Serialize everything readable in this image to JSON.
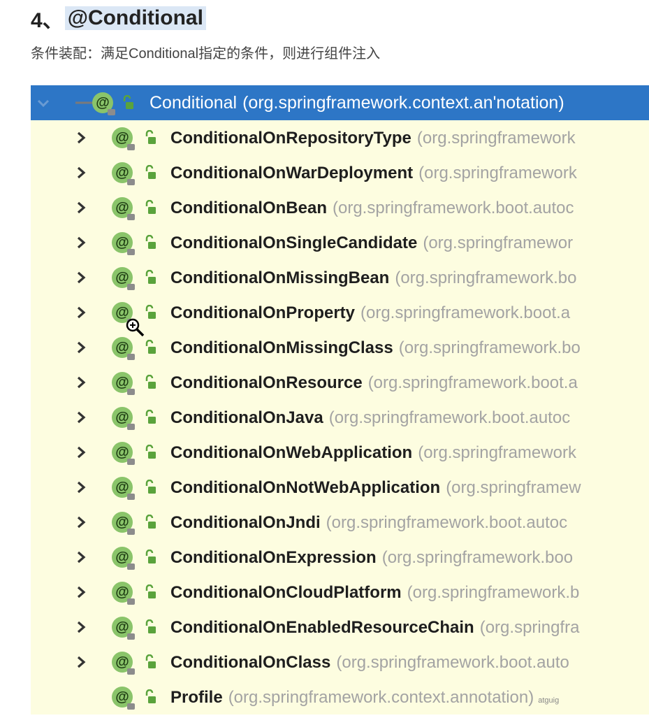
{
  "heading": {
    "number": "4、",
    "title": "@Conditional"
  },
  "description": "条件装配：满足Conditional指定的条件，则进行组件注入",
  "tree": {
    "root": {
      "name": "Conditional",
      "package": "(org.springframework.context.an'notation)"
    },
    "items": [
      {
        "name": "ConditionalOnRepositoryType",
        "package": "(org.springframework"
      },
      {
        "name": "ConditionalOnWarDeployment",
        "package": "(org.springframework"
      },
      {
        "name": "ConditionalOnBean",
        "package": "(org.springframework.boot.autoc"
      },
      {
        "name": "ConditionalOnSingleCandidate",
        "package": "(org.springframewor"
      },
      {
        "name": "ConditionalOnMissingBean",
        "package": "(org.springframework.bo"
      },
      {
        "name": "ConditionalOnProperty",
        "package": "(org.springframework.boot.a"
      },
      {
        "name": "ConditionalOnMissingClass",
        "package": "(org.springframework.bo"
      },
      {
        "name": "ConditionalOnResource",
        "package": "(org.springframework.boot.a"
      },
      {
        "name": "ConditionalOnJava",
        "package": "(org.springframework.boot.autoc"
      },
      {
        "name": "ConditionalOnWebApplication",
        "package": "(org.springframework"
      },
      {
        "name": "ConditionalOnNotWebApplication",
        "package": "(org.springframew"
      },
      {
        "name": "ConditionalOnJndi",
        "package": "(org.springframework.boot.autoc"
      },
      {
        "name": "ConditionalOnExpression",
        "package": "(org.springframework.boo"
      },
      {
        "name": "ConditionalOnCloudPlatform",
        "package": "(org.springframework.b"
      },
      {
        "name": "ConditionalOnEnabledResourceChain",
        "package": "(org.springfra"
      },
      {
        "name": "ConditionalOnClass",
        "package": "(org.springframework.boot.auto"
      },
      {
        "name": "Profile",
        "package": "(org.springframework.context.annotation)"
      }
    ],
    "watermark": "atguig"
  },
  "icons": {
    "annotation": "@",
    "expand": "chevron-right-icon",
    "collapse": "chevron-down-icon"
  },
  "colors": {
    "selection": "#2d76c6",
    "tree_background": "#fdfde0",
    "annotation_icon": "#8ac46a",
    "package_text": "#a3a3a3"
  }
}
